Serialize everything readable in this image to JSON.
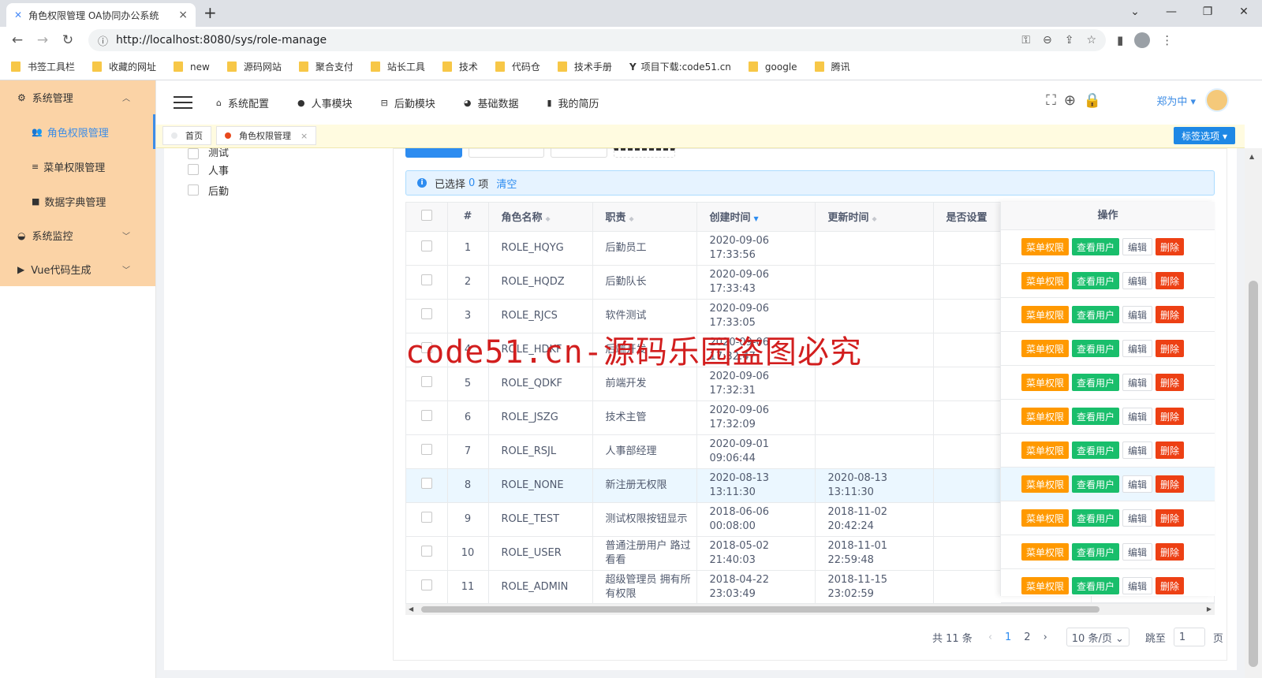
{
  "browser": {
    "tab_title": "角色权限管理 OA协同办公系统",
    "tab_close": "×",
    "new_tab": "+",
    "url": "http://localhost:8080/sys/role-manage",
    "bookmarks": [
      "书签工具栏",
      "收藏的网址",
      "new",
      "源码网站",
      "聚合支付",
      "站长工具",
      "技术",
      "代码仓",
      "技术手册",
      "项目下载:code51.cn",
      "google",
      "腾讯"
    ]
  },
  "sidebar": {
    "groups": [
      {
        "label": "系统管理",
        "icon": "gear-icon",
        "expanded": true,
        "items": [
          {
            "label": "角色权限管理",
            "active": true
          },
          {
            "label": "菜单权限管理"
          },
          {
            "label": "数据字典管理"
          }
        ]
      },
      {
        "label": "系统监控",
        "icon": "monitor-icon",
        "expanded": false
      },
      {
        "label": "Vue代码生成",
        "icon": "play-icon",
        "expanded": false
      }
    ]
  },
  "header": {
    "nav": [
      "系统配置",
      "人事模块",
      "后勤模块",
      "基础数据",
      "我的简历"
    ],
    "user": "郑为中 ▾"
  },
  "tags": {
    "home": "首页",
    "current": "角色权限管理",
    "close": "×",
    "options": "标签选项 ▾"
  },
  "tree": [
    "测试",
    "人事",
    "后勤"
  ],
  "alert": {
    "prefix": "已选择",
    "count": "0",
    "suffix": "项",
    "clear": "清空"
  },
  "table": {
    "columns": [
      "#",
      "角色名称",
      "职责",
      "创建时间",
      "更新时间",
      "是否设置"
    ],
    "op_header": "操作",
    "op_buttons": {
      "menu": "菜单权限",
      "user": "查看用户",
      "edit": "编辑",
      "del": "删除"
    },
    "rows": [
      {
        "no": "1",
        "name": "ROLE_HQYG",
        "duty": "后勤员工",
        "created": "2020-09-06 17:33:56",
        "updated": ""
      },
      {
        "no": "2",
        "name": "ROLE_HQDZ",
        "duty": "后勤队长",
        "created": "2020-09-06 17:33:43",
        "updated": ""
      },
      {
        "no": "3",
        "name": "ROLE_RJCS",
        "duty": "软件测试",
        "created": "2020-09-06 17:33:05",
        "updated": ""
      },
      {
        "no": "4",
        "name": "ROLE_HDKF",
        "duty": "后端开发",
        "created": "2020-09-06 17:32:47",
        "updated": ""
      },
      {
        "no": "5",
        "name": "ROLE_QDKF",
        "duty": "前端开发",
        "created": "2020-09-06 17:32:31",
        "updated": ""
      },
      {
        "no": "6",
        "name": "ROLE_JSZG",
        "duty": "技术主管",
        "created": "2020-09-06 17:32:09",
        "updated": ""
      },
      {
        "no": "7",
        "name": "ROLE_RSJL",
        "duty": "人事部经理",
        "created": "2020-09-01 09:06:44",
        "updated": ""
      },
      {
        "no": "8",
        "name": "ROLE_NONE",
        "duty": "新注册无权限",
        "created": "2020-08-13 13:11:30",
        "updated": "2020-08-13 13:11:30"
      },
      {
        "no": "9",
        "name": "ROLE_TEST",
        "duty": "测试权限按钮显示",
        "created": "2018-06-06 00:08:00",
        "updated": "2018-11-02 20:42:24"
      },
      {
        "no": "10",
        "name": "ROLE_USER",
        "duty": "普通注册用户 路过看看",
        "created": "2018-05-02 21:40:03",
        "updated": "2018-11-01 22:59:48"
      },
      {
        "no": "11",
        "name": "ROLE_ADMIN",
        "duty": "超级管理员 拥有所有权限",
        "created": "2018-04-22 23:03:49",
        "updated": "2018-11-15 23:02:59"
      }
    ]
  },
  "pager": {
    "total": "共 11 条",
    "pages": [
      "1",
      "2"
    ],
    "size": "10 条/页 ⌄",
    "jump": "跳至",
    "jump_value": "1",
    "page_unit": "页"
  },
  "watermark": "code51.cn-源码乐园盗图必究",
  "colors": {
    "accent": "#2d8cf0",
    "sidebar_bg": "#fbd3a6",
    "menu_btn": "#ff9900",
    "user_btn": "#19be6b",
    "del_btn": "#ed4014"
  }
}
